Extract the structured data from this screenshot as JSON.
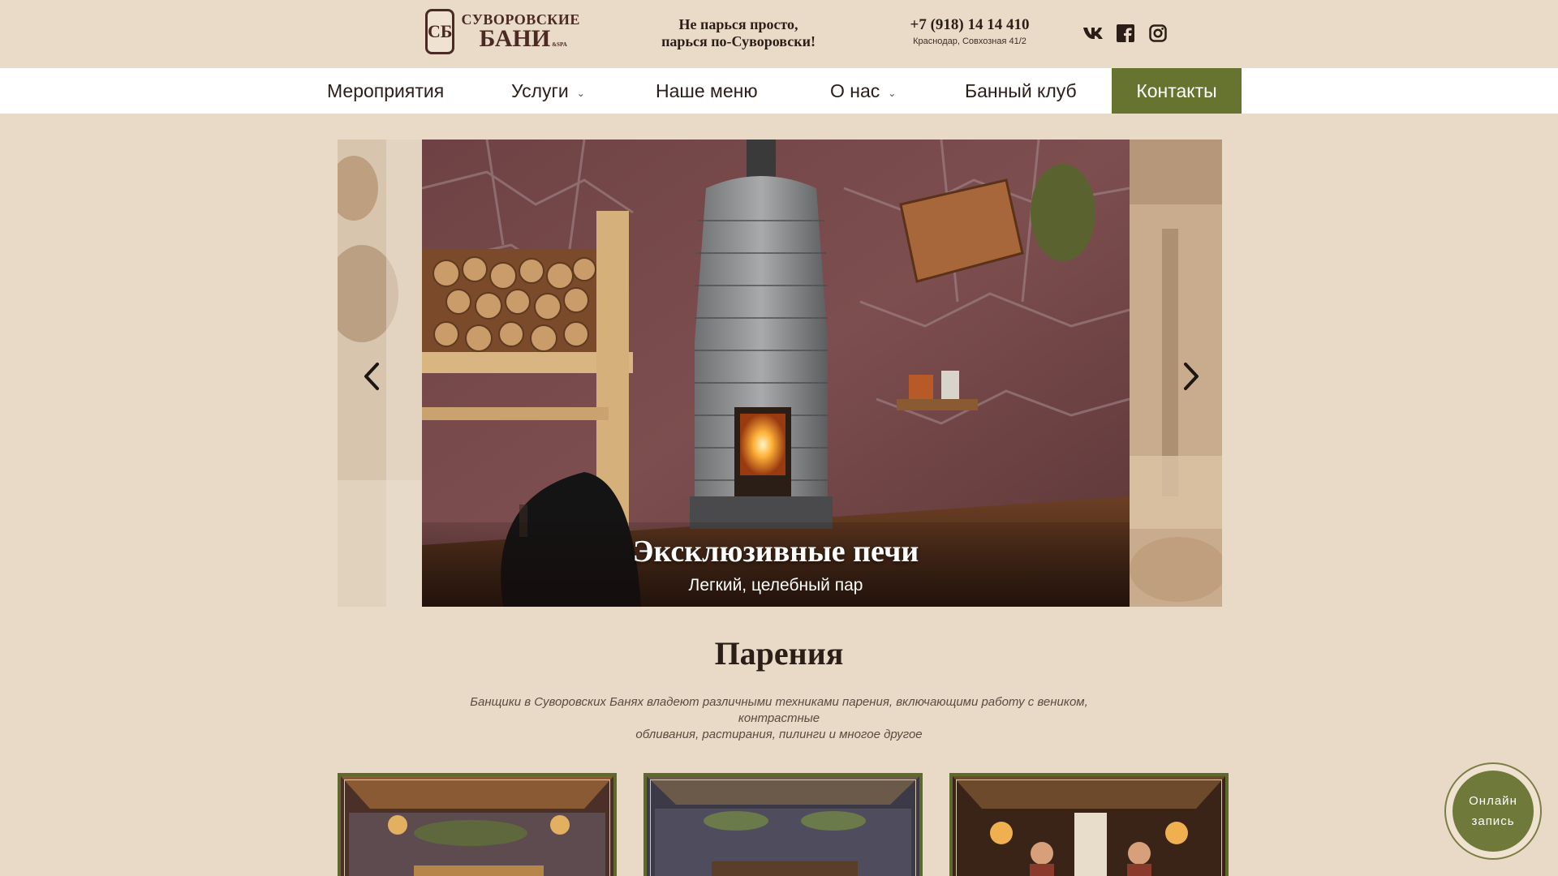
{
  "header": {
    "logo": {
      "line1": "СУВОРОВСКИЕ",
      "line2": "БАНИ",
      "sup": "&SPA"
    },
    "slogan": {
      "line1": "Не парься просто,",
      "line2": "парься по-Суворовски!"
    },
    "phone": "+7 (918) 14 14 410",
    "address": "Краснодар, Совхозная 41/2",
    "socials": [
      "vk-icon",
      "facebook-icon",
      "instagram-icon"
    ]
  },
  "nav": {
    "items": [
      {
        "label": "Мероприятия",
        "dropdown": false
      },
      {
        "label": "Услуги",
        "dropdown": true
      },
      {
        "label": "Наше меню",
        "dropdown": false
      },
      {
        "label": "О нас",
        "dropdown": true
      },
      {
        "label": "Банный клуб",
        "dropdown": false
      },
      {
        "label": "Контакты",
        "dropdown": false,
        "active": true
      }
    ]
  },
  "slider": {
    "title": "Эксклюзивные печи",
    "subtitle": "Легкий, целебный пар",
    "prev_icon": "chevron-left-icon",
    "next_icon": "chevron-right-icon"
  },
  "section": {
    "title": "Парения",
    "description_line1": "Банщики в Суворовских Банях владеют различными техниками парения, включающими работу с веником, контрастные",
    "description_line2": "обливания, растирания, пилинги и многое другое"
  },
  "online_button": {
    "line1": "Онлайн",
    "line2": "запись"
  },
  "colors": {
    "background": "#e9dac8",
    "accent_green": "#67742f",
    "text_dark": "#2a1e17"
  }
}
